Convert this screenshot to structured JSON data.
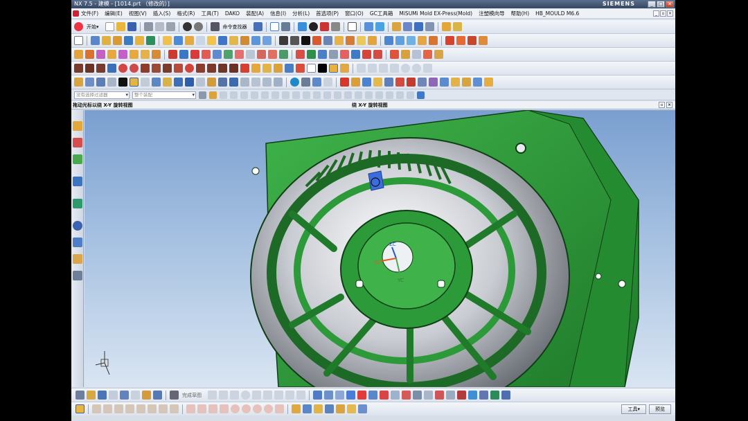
{
  "window": {
    "title": "NX 7.5 - 建模 - [1014.prt （修改的）]",
    "brand": "SIEMENS",
    "controls": [
      "_",
      "□",
      "✕"
    ]
  },
  "menu": {
    "items": [
      "文件(F)",
      "编辑(E)",
      "视图(V)",
      "插入(S)",
      "格式(R)",
      "工具(T)",
      "DAKO",
      "装配(A)",
      "信息(I)",
      "分析(L)",
      "首选项(P)",
      "窗口(O)",
      "GC工具箱",
      "MiSUMi Mold EX-Press(Mold)",
      "注塑模向导",
      "帮助(H)",
      "HB_MOULD M6.6"
    ]
  },
  "toolbar": {
    "start_label": "开始▾",
    "command_finder_label": "命令查找器"
  },
  "selection": {
    "filter_placeholder": "没有选择过滤器",
    "assembly_placeholder": "整个装配"
  },
  "status": {
    "left": "拖动光标以绕 X-Y 旋转视图",
    "center": "绕 X-Y 旋转视图"
  },
  "sketch": {
    "label": "完成草图"
  },
  "prompt": {
    "tools_label": "工具▾",
    "preview_label": "预览"
  },
  "triad": {
    "zc": "ZC",
    "yc": "YC",
    "xc": "XC"
  },
  "colors": {
    "part_green": "#2d9a3a",
    "part_dark_green": "#1c6a25",
    "selection_blue": "#3b6ddc",
    "background_top": "#7a9fd0",
    "background_bottom": "#d9e5f2"
  }
}
